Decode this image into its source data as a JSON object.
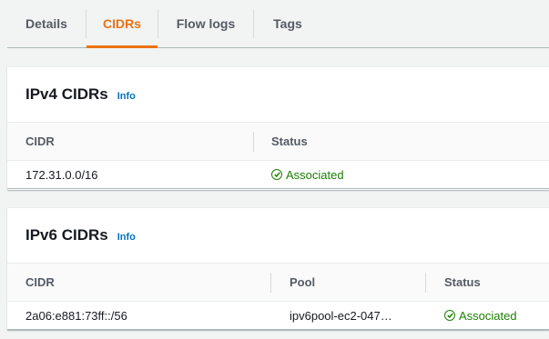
{
  "tabs": [
    {
      "label": "Details"
    },
    {
      "label": "CIDRs"
    },
    {
      "label": "Flow logs"
    },
    {
      "label": "Tags"
    }
  ],
  "active_tab": "CIDRs",
  "ipv4": {
    "title": "IPv4 CIDRs",
    "info": "Info",
    "columns": [
      "CIDR",
      "Status"
    ],
    "rows": [
      {
        "cidr": "172.31.0.0/16",
        "status": "Associated"
      }
    ]
  },
  "ipv6": {
    "title": "IPv6 CIDRs",
    "info": "Info",
    "columns": [
      "CIDR",
      "Pool",
      "Status"
    ],
    "rows": [
      {
        "cidr": "2a06:e881:73ff::/56",
        "pool": "ipv6pool-ec2-047…",
        "status": "Associated"
      }
    ]
  },
  "colors": {
    "accent": "#ec7211",
    "link": "#0073bb",
    "success": "#1d8102"
  },
  "icons": {
    "status": "status-positive-icon"
  }
}
